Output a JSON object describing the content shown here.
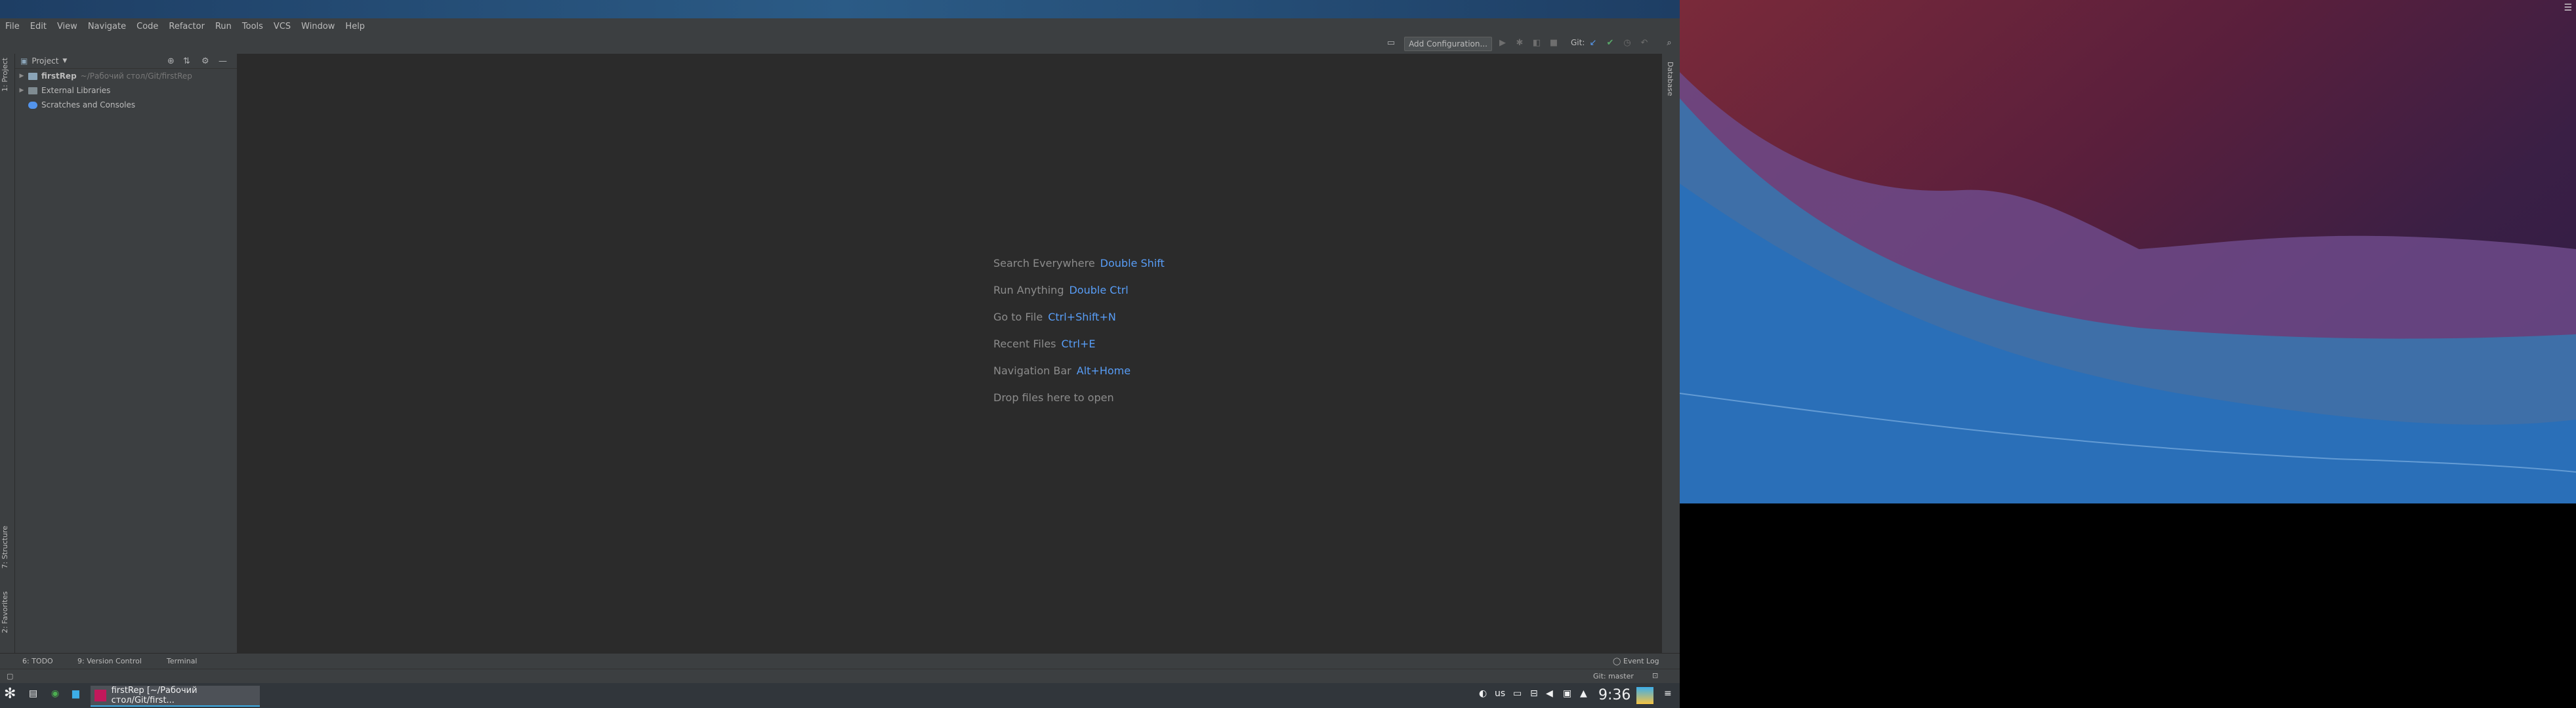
{
  "menu": [
    "File",
    "Edit",
    "View",
    "Navigate",
    "Code",
    "Refactor",
    "Run",
    "Tools",
    "VCS",
    "Window",
    "Help"
  ],
  "toolbar": {
    "config_label": "Add Configuration...",
    "git_label": "Git:"
  },
  "left_strip": {
    "project_tab": "1: Project",
    "structure_tab": "7: Structure",
    "favorites_tab": "2: Favorites"
  },
  "right_strip": {
    "database_tab": "Database"
  },
  "project_panel": {
    "title": "Project",
    "tree": [
      {
        "name": "firstRep",
        "hint": "~/Рабочий стол/Git/firstRep"
      },
      {
        "name": "External Libraries",
        "hint": ""
      },
      {
        "name": "Scratches and Consoles",
        "hint": ""
      }
    ]
  },
  "editor_hints": [
    {
      "label": "Search Everywhere",
      "key": "Double Shift"
    },
    {
      "label": "Run Anything",
      "key": "Double Ctrl"
    },
    {
      "label": "Go to File",
      "key": "Ctrl+Shift+N"
    },
    {
      "label": "Recent Files",
      "key": "Ctrl+E"
    },
    {
      "label": "Navigation Bar",
      "key": "Alt+Home"
    },
    {
      "label": "Drop files here to open",
      "key": ""
    }
  ],
  "bottom_tools": {
    "todo": "6: TODO",
    "vcs": "9: Version Control",
    "terminal": "Terminal",
    "event_log": "Event Log"
  },
  "statusbar": {
    "git_branch": "Git: master"
  },
  "taskbar": {
    "task_label": "firstRep [~/Рабочий стол/Git/first...",
    "keyboard": "us",
    "clock": "9:36"
  }
}
